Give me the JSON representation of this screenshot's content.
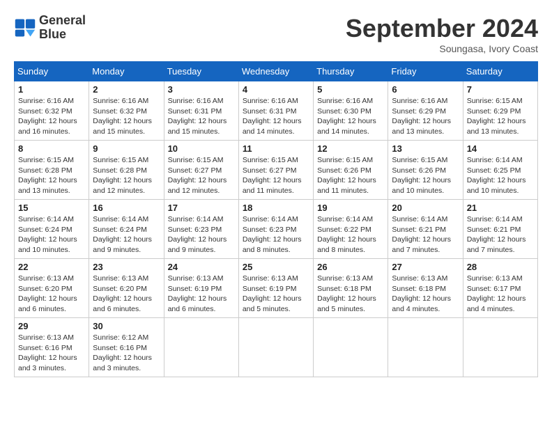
{
  "header": {
    "logo_line1": "General",
    "logo_line2": "Blue",
    "month": "September 2024",
    "location": "Soungasa, Ivory Coast"
  },
  "weekdays": [
    "Sunday",
    "Monday",
    "Tuesday",
    "Wednesday",
    "Thursday",
    "Friday",
    "Saturday"
  ],
  "weeks": [
    [
      {
        "day": "1",
        "info": "Sunrise: 6:16 AM\nSunset: 6:32 PM\nDaylight: 12 hours\nand 16 minutes."
      },
      {
        "day": "2",
        "info": "Sunrise: 6:16 AM\nSunset: 6:32 PM\nDaylight: 12 hours\nand 15 minutes."
      },
      {
        "day": "3",
        "info": "Sunrise: 6:16 AM\nSunset: 6:31 PM\nDaylight: 12 hours\nand 15 minutes."
      },
      {
        "day": "4",
        "info": "Sunrise: 6:16 AM\nSunset: 6:31 PM\nDaylight: 12 hours\nand 14 minutes."
      },
      {
        "day": "5",
        "info": "Sunrise: 6:16 AM\nSunset: 6:30 PM\nDaylight: 12 hours\nand 14 minutes."
      },
      {
        "day": "6",
        "info": "Sunrise: 6:16 AM\nSunset: 6:29 PM\nDaylight: 12 hours\nand 13 minutes."
      },
      {
        "day": "7",
        "info": "Sunrise: 6:15 AM\nSunset: 6:29 PM\nDaylight: 12 hours\nand 13 minutes."
      }
    ],
    [
      {
        "day": "8",
        "info": "Sunrise: 6:15 AM\nSunset: 6:28 PM\nDaylight: 12 hours\nand 13 minutes."
      },
      {
        "day": "9",
        "info": "Sunrise: 6:15 AM\nSunset: 6:28 PM\nDaylight: 12 hours\nand 12 minutes."
      },
      {
        "day": "10",
        "info": "Sunrise: 6:15 AM\nSunset: 6:27 PM\nDaylight: 12 hours\nand 12 minutes."
      },
      {
        "day": "11",
        "info": "Sunrise: 6:15 AM\nSunset: 6:27 PM\nDaylight: 12 hours\nand 11 minutes."
      },
      {
        "day": "12",
        "info": "Sunrise: 6:15 AM\nSunset: 6:26 PM\nDaylight: 12 hours\nand 11 minutes."
      },
      {
        "day": "13",
        "info": "Sunrise: 6:15 AM\nSunset: 6:26 PM\nDaylight: 12 hours\nand 10 minutes."
      },
      {
        "day": "14",
        "info": "Sunrise: 6:14 AM\nSunset: 6:25 PM\nDaylight: 12 hours\nand 10 minutes."
      }
    ],
    [
      {
        "day": "15",
        "info": "Sunrise: 6:14 AM\nSunset: 6:24 PM\nDaylight: 12 hours\nand 10 minutes."
      },
      {
        "day": "16",
        "info": "Sunrise: 6:14 AM\nSunset: 6:24 PM\nDaylight: 12 hours\nand 9 minutes."
      },
      {
        "day": "17",
        "info": "Sunrise: 6:14 AM\nSunset: 6:23 PM\nDaylight: 12 hours\nand 9 minutes."
      },
      {
        "day": "18",
        "info": "Sunrise: 6:14 AM\nSunset: 6:23 PM\nDaylight: 12 hours\nand 8 minutes."
      },
      {
        "day": "19",
        "info": "Sunrise: 6:14 AM\nSunset: 6:22 PM\nDaylight: 12 hours\nand 8 minutes."
      },
      {
        "day": "20",
        "info": "Sunrise: 6:14 AM\nSunset: 6:21 PM\nDaylight: 12 hours\nand 7 minutes."
      },
      {
        "day": "21",
        "info": "Sunrise: 6:14 AM\nSunset: 6:21 PM\nDaylight: 12 hours\nand 7 minutes."
      }
    ],
    [
      {
        "day": "22",
        "info": "Sunrise: 6:13 AM\nSunset: 6:20 PM\nDaylight: 12 hours\nand 6 minutes."
      },
      {
        "day": "23",
        "info": "Sunrise: 6:13 AM\nSunset: 6:20 PM\nDaylight: 12 hours\nand 6 minutes."
      },
      {
        "day": "24",
        "info": "Sunrise: 6:13 AM\nSunset: 6:19 PM\nDaylight: 12 hours\nand 6 minutes."
      },
      {
        "day": "25",
        "info": "Sunrise: 6:13 AM\nSunset: 6:19 PM\nDaylight: 12 hours\nand 5 minutes."
      },
      {
        "day": "26",
        "info": "Sunrise: 6:13 AM\nSunset: 6:18 PM\nDaylight: 12 hours\nand 5 minutes."
      },
      {
        "day": "27",
        "info": "Sunrise: 6:13 AM\nSunset: 6:18 PM\nDaylight: 12 hours\nand 4 minutes."
      },
      {
        "day": "28",
        "info": "Sunrise: 6:13 AM\nSunset: 6:17 PM\nDaylight: 12 hours\nand 4 minutes."
      }
    ],
    [
      {
        "day": "29",
        "info": "Sunrise: 6:13 AM\nSunset: 6:16 PM\nDaylight: 12 hours\nand 3 minutes."
      },
      {
        "day": "30",
        "info": "Sunrise: 6:12 AM\nSunset: 6:16 PM\nDaylight: 12 hours\nand 3 minutes."
      },
      null,
      null,
      null,
      null,
      null
    ]
  ]
}
